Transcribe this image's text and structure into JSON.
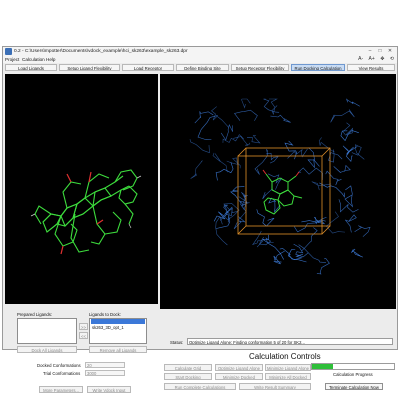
{
  "window": {
    "title": "0.2 - C:\\Users\\mpotter\\Documents\\vdock_example\\hci_sk263\\example_sk263.dpr",
    "controls": [
      "–",
      "□",
      "✕"
    ]
  },
  "menubar": {
    "items": [
      "Project",
      "Calculation",
      "Help"
    ]
  },
  "toolbar_right": {
    "font_smaller": "A-",
    "font_larger": "A+",
    "icons": [
      "pan-icon",
      "rotate-icon"
    ]
  },
  "tabs": [
    {
      "label": "Load Ligands",
      "active": false
    },
    {
      "label": "Setup Ligand Flexibility",
      "active": false
    },
    {
      "label": "Load Receptor",
      "active": false
    },
    {
      "label": "Define Binding Site",
      "active": false
    },
    {
      "label": "Setup Receptor Flexibility",
      "active": false
    },
    {
      "label": "Run Docking Calculation",
      "active": true
    },
    {
      "label": "View Results",
      "active": false
    }
  ],
  "left_panel": {
    "prepared_label": "Prepared Ligands:",
    "to_dock_label": "Ligands to Dock:",
    "to_dock_items": [
      {
        "text": "",
        "selected": true
      },
      {
        "text": "sk263_3D_opt_1",
        "selected": false
      }
    ],
    "add_button": ">>",
    "remove_button": "<<",
    "dock_all_button": "Dock All Ligands",
    "remove_all_button": "Remove all Ligands",
    "docked_conf_label": "Docked Conformations",
    "docked_conf_value": "20",
    "trial_conf_label": "Trial Conformations",
    "trial_conf_value": "3000",
    "more_params_button": "More Parameters...",
    "write_input_button": "Write Vdock Input"
  },
  "status": {
    "label": "Status:",
    "text": "Optimize Ligand Alone: Finding conformation 5 of 20 for SK2..."
  },
  "calc_controls": {
    "title": "Calculation Controls",
    "calculate_grid": "Calculate Grid",
    "optimize_ligand_alone": "Optimize Ligand Alone",
    "minimize_ligand_alone": "Minimize Ligand Alone",
    "start_docking": "Start Docking",
    "minimize_docked": "Minimize Docked",
    "minimize_all_docked": "Minimize All Docked",
    "run_complete": "Run Complete Calculations",
    "write_summary": "Write Result Summary",
    "progress_label": "Calculation Progress",
    "progress_fraction": 0.25,
    "terminate_button": "Terminate Calculation Now"
  },
  "colors": {
    "viewer_bg": "#000000",
    "ligand": "#3ddc3d",
    "ligand_oxygen": "#e03030",
    "protein": "#3f7fe0",
    "binding_box": "#e0902a",
    "active_tab": "#c9dcf4",
    "progress": "#2fbf3a"
  }
}
